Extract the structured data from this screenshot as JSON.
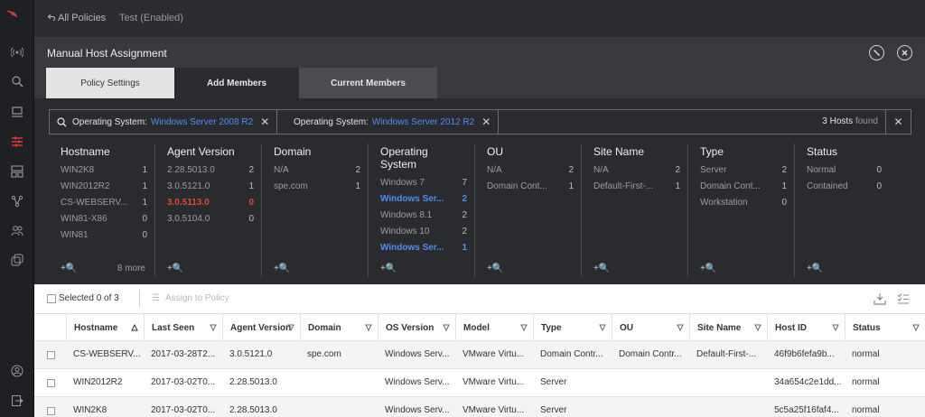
{
  "topbar": {
    "back_label": "All Policies",
    "current": "Test (Enabled)"
  },
  "panel": {
    "title": "Manual Host Assignment",
    "tabs": [
      {
        "label": "Policy Settings"
      },
      {
        "label": "Add Members"
      },
      {
        "label": "Current Members"
      }
    ]
  },
  "filters": {
    "chips": [
      {
        "key": "Operating System:",
        "value": "Windows Server 2008 R2"
      },
      {
        "key": "Operating System:",
        "value": "Windows Server 2012 R2"
      }
    ],
    "found_count": "3 Hosts",
    "found_word": "found"
  },
  "facets": [
    {
      "title": "Hostname",
      "rows": [
        {
          "label": "WIN2K8",
          "count": "1"
        },
        {
          "label": "WIN2012R2",
          "count": "1"
        },
        {
          "label": "CS-WEBSERV...",
          "count": "1"
        },
        {
          "label": "WIN81-X86",
          "count": "0"
        },
        {
          "label": "WIN81",
          "count": "0"
        }
      ],
      "add": "+🔍",
      "more": "8 more"
    },
    {
      "title": "Agent Version",
      "rows": [
        {
          "label": "2.28.5013.0",
          "count": "2"
        },
        {
          "label": "3.0.5121.0",
          "count": "1"
        },
        {
          "label": "3.0.5113.0",
          "count": "0",
          "state": "red"
        },
        {
          "label": "3.0.5104.0",
          "count": "0"
        }
      ],
      "add": "+🔍"
    },
    {
      "title": "Domain",
      "rows": [
        {
          "label": "N/A",
          "count": "2"
        },
        {
          "label": "spe.com",
          "count": "1"
        }
      ],
      "add": "+🔍"
    },
    {
      "title": "Operating System",
      "rows": [
        {
          "label": "Windows 7",
          "count": "7"
        },
        {
          "label": "Windows Ser...",
          "count": "2",
          "state": "sel"
        },
        {
          "label": "Windows 8.1",
          "count": "2"
        },
        {
          "label": "Windows 10",
          "count": "2"
        },
        {
          "label": "Windows Ser...",
          "count": "1",
          "state": "sel"
        }
      ],
      "add": "+🔍"
    },
    {
      "title": "OU",
      "rows": [
        {
          "label": "N/A",
          "count": "2"
        },
        {
          "label": "Domain Cont...",
          "count": "1"
        }
      ],
      "add": "+🔍"
    },
    {
      "title": "Site Name",
      "rows": [
        {
          "label": "N/A",
          "count": "2"
        },
        {
          "label": "Default-First-...",
          "count": "1"
        }
      ],
      "add": "+🔍"
    },
    {
      "title": "Type",
      "rows": [
        {
          "label": "Server",
          "count": "2"
        },
        {
          "label": "Domain Cont...",
          "count": "1"
        },
        {
          "label": "Workstation",
          "count": "0"
        }
      ],
      "add": "+🔍"
    },
    {
      "title": "Status",
      "rows": [
        {
          "label": "Normal",
          "count": "0"
        },
        {
          "label": "Contained",
          "count": "0"
        }
      ],
      "add": "+🔍"
    }
  ],
  "results": {
    "selected": "Selected 0 of 3",
    "assign": "Assign to Policy",
    "columns": [
      "Hostname",
      "Last Seen",
      "Agent Version",
      "Domain",
      "OS Version",
      "Model",
      "Type",
      "OU",
      "Site Name",
      "Host ID",
      "Status"
    ],
    "rows": [
      [
        "CS-WEBSERV...",
        "2017-03-28T2...",
        "3.0.5121.0",
        "spe.com",
        "Windows Serv...",
        "VMware Virtu...",
        "Domain Contr...",
        "Domain Contr...",
        "Default-First-...",
        "46f9b6fefa9b...",
        "normal"
      ],
      [
        "WIN2012R2",
        "2017-03-02T0...",
        "2.28.5013.0",
        "",
        "Windows Serv...",
        "VMware Virtu...",
        "Server",
        "",
        "",
        "34a654c2e1dd...",
        "normal"
      ],
      [
        "WIN2K8",
        "2017-03-02T0...",
        "2.28.5013.0",
        "",
        "Windows Serv...",
        "VMware Virtu...",
        "Server",
        "",
        "",
        "5c5a25f16faf4...",
        "normal"
      ]
    ]
  },
  "colors": {
    "accent_blue": "#4f8ff0",
    "alert_red": "#e6443d",
    "brand_red": "#e23b3b"
  }
}
